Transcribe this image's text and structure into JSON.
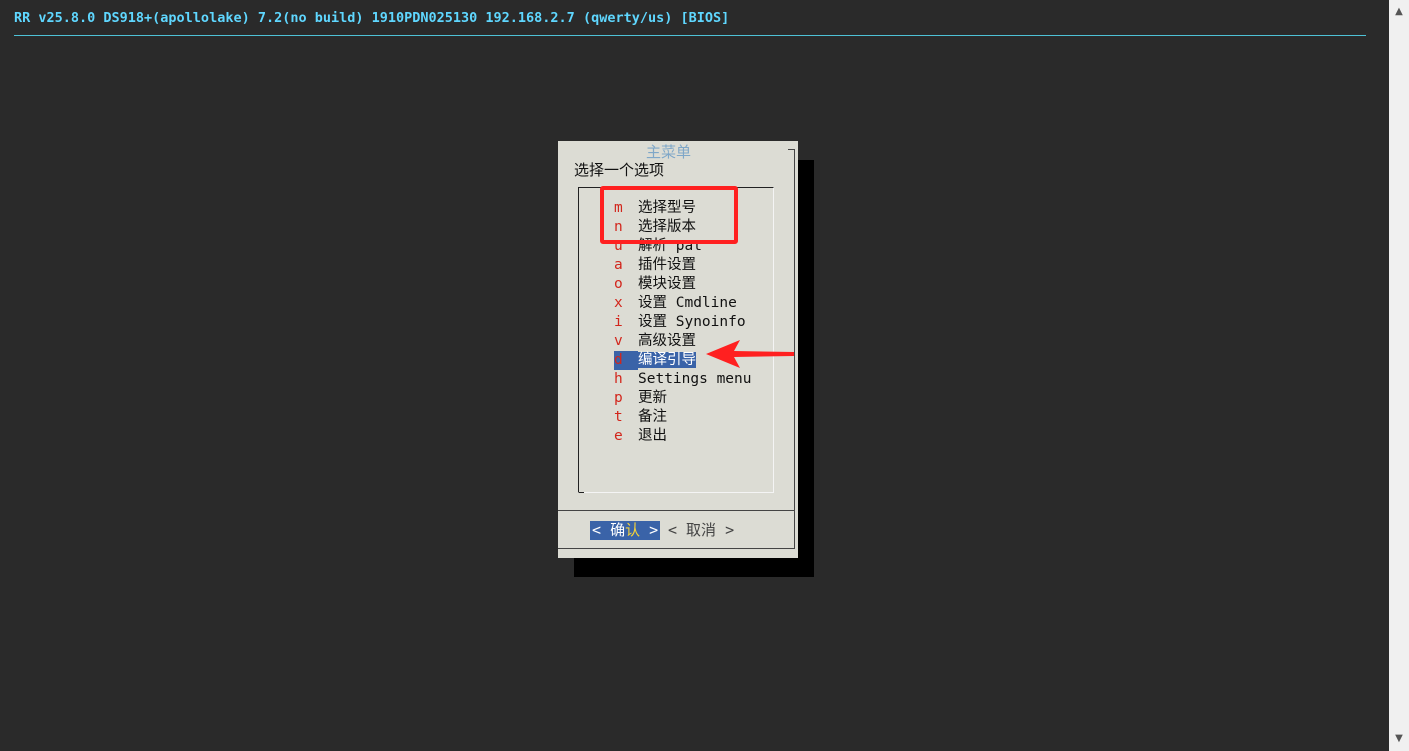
{
  "header": {
    "text": "RR v25.8.0 DS918+(apollolake) 7.2(no build) 1910PDN025130 192.168.2.7 (qwerty/us) [BIOS]"
  },
  "dialog": {
    "title": "主菜单",
    "prompt": "选择一个选项",
    "items": [
      {
        "key": "m",
        "label": "选择型号"
      },
      {
        "key": "n",
        "label": "选择版本"
      },
      {
        "key": "u",
        "label": "解析 pat"
      },
      {
        "key": "a",
        "label": "插件设置"
      },
      {
        "key": "o",
        "label": "模块设置"
      },
      {
        "key": "x",
        "label": "设置 Cmdline"
      },
      {
        "key": "i",
        "label": "设置 Synoinfo"
      },
      {
        "key": "v",
        "label": "高级设置"
      },
      {
        "key": "d",
        "label": "编译引导"
      },
      {
        "key": "h",
        "label": "Settings menu"
      },
      {
        "key": "p",
        "label": "更新"
      },
      {
        "key": "t",
        "label": "备注"
      },
      {
        "key": "e",
        "label": "退出"
      }
    ],
    "selected_index": 8,
    "buttons": {
      "ok_left": "< ",
      "ok_main": "确",
      "ok_hot": "认",
      "ok_right": " >",
      "cancel": "< 取消 >"
    }
  },
  "scrollbar": {
    "up_icon": "▲",
    "down_icon": "▼"
  },
  "annotation_colors": {
    "highlight": "#ff2020"
  }
}
